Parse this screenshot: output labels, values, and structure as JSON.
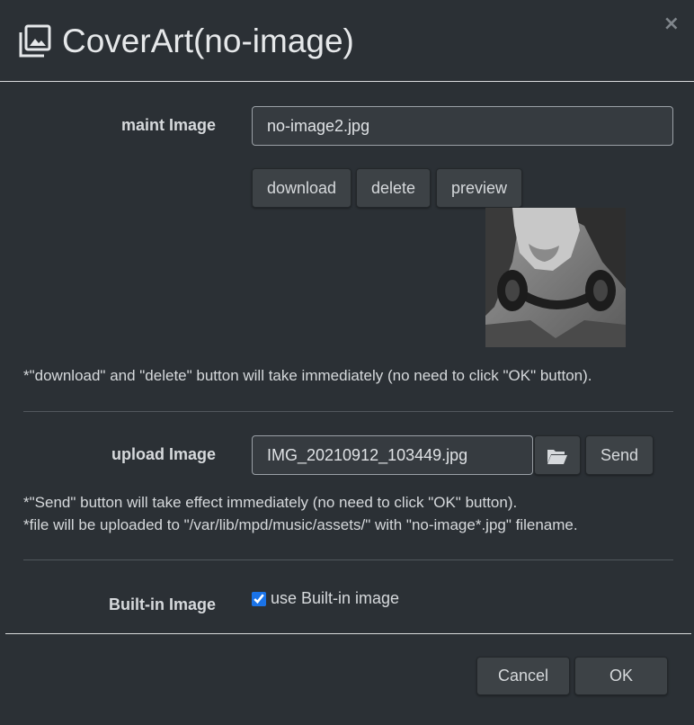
{
  "dialog": {
    "title": "CoverArt(no-image)",
    "close_label": "×"
  },
  "maint": {
    "label": "maint Image",
    "value": "no-image2.jpg",
    "buttons": {
      "download": "download",
      "delete": "delete",
      "preview": "preview"
    },
    "note": "*\"download\" and \"delete\" button will take immediately (no need to click \"OK\" button)."
  },
  "upload": {
    "label": "upload Image",
    "value": "IMG_20210912_103449.jpg",
    "send_label": "Send",
    "note_1": "*\"Send\" button will take effect immediately (no need to click \"OK\" button).",
    "note_2": "*file will be uploaded to \"/var/lib/mpd/music/assets/\" with \"no-image*.jpg\" filename."
  },
  "builtin": {
    "label": "Built-in Image",
    "checkbox_label": "use Built-in image",
    "checked": true
  },
  "footer": {
    "cancel_label": "Cancel",
    "ok_label": "OK"
  },
  "icons": {
    "title": "image-gallery-icon",
    "browse": "folder-open-icon"
  },
  "colors": {
    "background": "#2b3035",
    "button": "#3d4246",
    "input": "#363b40",
    "checkbox": "#1a73e8"
  }
}
